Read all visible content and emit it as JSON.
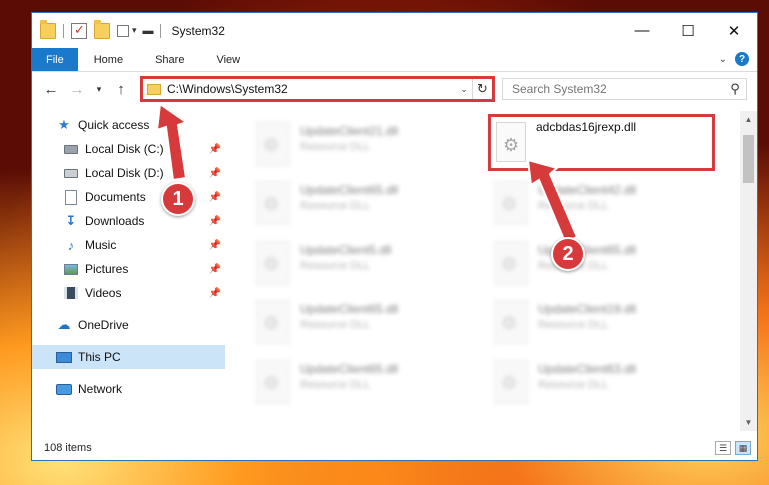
{
  "window": {
    "title": "System32",
    "controls": {
      "minimize": "—",
      "maximize": "☐",
      "close": "✕"
    }
  },
  "ribbon": {
    "tabs": [
      {
        "label": "File"
      },
      {
        "label": "Home"
      },
      {
        "label": "Share"
      },
      {
        "label": "View"
      }
    ],
    "expand_icon": "chevron-down-icon",
    "help": "?"
  },
  "navigation": {
    "back": "←",
    "forward": "→",
    "recent": "▾",
    "up": "↑",
    "address": "C:\\Windows\\System32",
    "search_placeholder": "Search System32"
  },
  "sidebar": {
    "items": [
      {
        "label": "Quick access"
      },
      {
        "label": "Local Disk (C:)"
      },
      {
        "label": "Local Disk (D:)"
      },
      {
        "label": "Documents"
      },
      {
        "label": "Downloads"
      },
      {
        "label": "Music"
      },
      {
        "label": "Pictures"
      },
      {
        "label": "Videos"
      },
      {
        "label": "OneDrive"
      },
      {
        "label": "This PC"
      },
      {
        "label": "Network"
      }
    ]
  },
  "files": [
    {
      "name": "UpdateClient21.dll",
      "type": "Resource DLL"
    },
    {
      "name": "adcbdas16jrexp.dll",
      "type": ""
    },
    {
      "name": "UpdateClient65.dll",
      "type": "Resource DLL"
    },
    {
      "name": "UpdateClient42.dll",
      "type": "Resource DLL"
    },
    {
      "name": "UpdateClient5.dll",
      "type": "Resource DLL"
    },
    {
      "name": "UpdateClient65.dll",
      "type": "Resource DLL"
    },
    {
      "name": "UpdateClient65.dll",
      "type": "Resource DLL"
    },
    {
      "name": "UpdateClient19.dll",
      "type": "Resource DLL"
    },
    {
      "name": "UpdateClient65.dll",
      "type": "Resource DLL"
    },
    {
      "name": "UpdateClient63.dll",
      "type": "Resource DLL"
    }
  ],
  "status": {
    "item_count": "108 items"
  },
  "annotations": {
    "step1": "1",
    "step2": "2",
    "color": "#d63a3a"
  }
}
